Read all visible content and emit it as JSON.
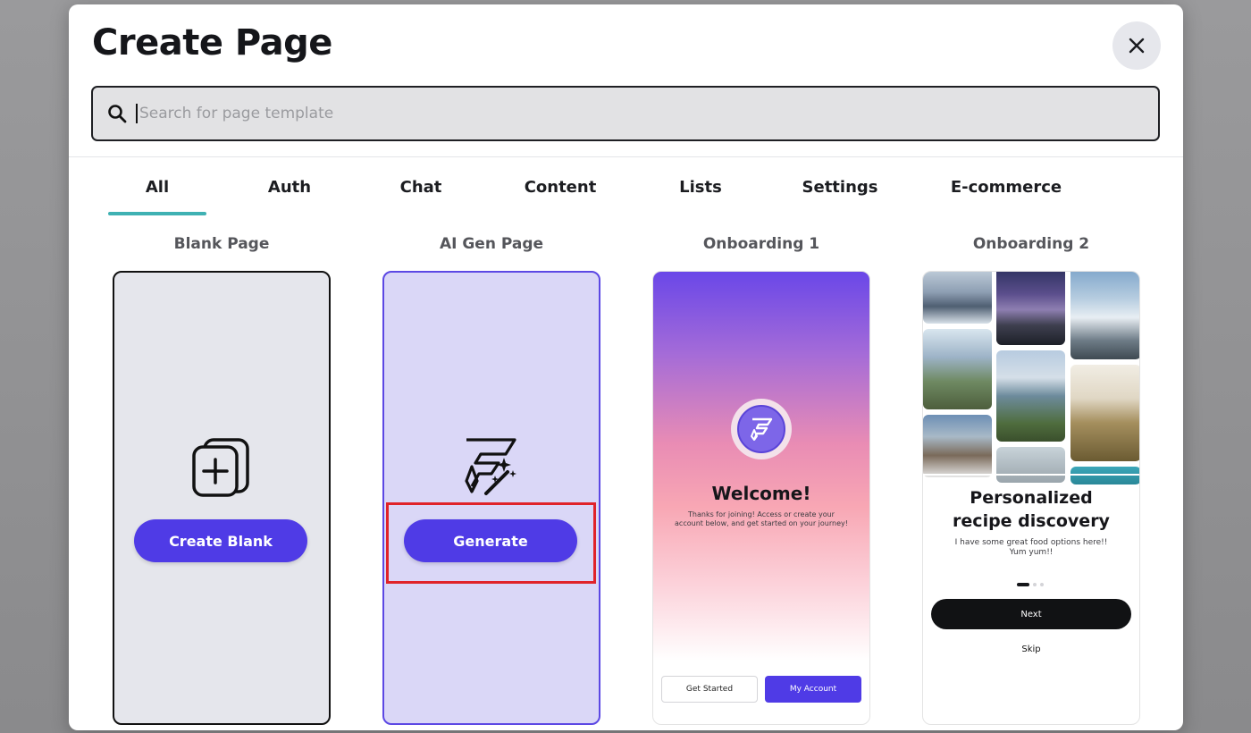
{
  "modal": {
    "title": "Create Page",
    "close_icon": "close-icon"
  },
  "search": {
    "placeholder": "Search for page template",
    "value": "",
    "icon": "search-icon"
  },
  "tabs": [
    {
      "label": "All",
      "active": true
    },
    {
      "label": "Auth",
      "active": false
    },
    {
      "label": "Chat",
      "active": false
    },
    {
      "label": "Content",
      "active": false
    },
    {
      "label": "Lists",
      "active": false
    },
    {
      "label": "Settings",
      "active": false
    },
    {
      "label": "E-commerce",
      "active": false
    }
  ],
  "cards": [
    {
      "title": "Blank Page",
      "button_label": "Create Blank",
      "icon": "add-page-icon"
    },
    {
      "title": "AI Gen Page",
      "button_label": "Generate",
      "icon": "ai-magic-wand-icon"
    },
    {
      "title": "Onboarding 1",
      "heading": "Welcome!",
      "subtext": "Thanks for joining! Access or create your account below, and get started on your journey!",
      "secondary_button": "Get Started",
      "primary_button": "My Account"
    },
    {
      "title": "Onboarding 2",
      "heading_line1": "Personalized",
      "heading_line2": "recipe discovery",
      "subtext": "I have some great food options here!! Yum yum!!",
      "next_button": "Next",
      "skip_label": "Skip"
    }
  ],
  "colors": {
    "accent": "#4f3be6",
    "tab_underline": "#3fb1b3",
    "highlight": "#e0232a",
    "ai_card_bg": "#dad7f7"
  }
}
